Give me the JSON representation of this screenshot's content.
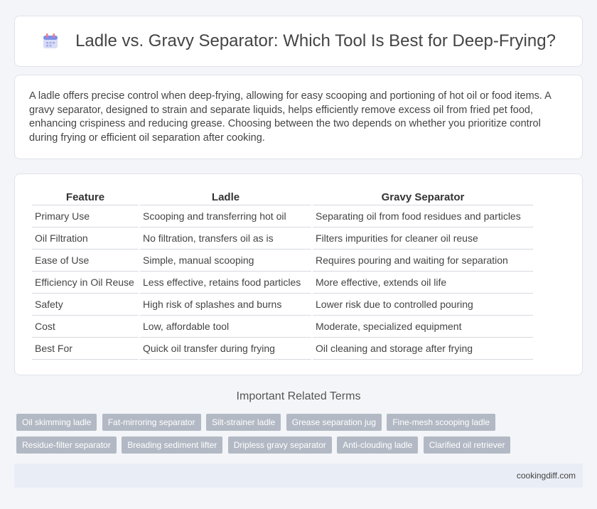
{
  "header": {
    "title": "Ladle vs. Gravy Separator: Which Tool Is Best for Deep-Frying?",
    "icon": "calendar-icon"
  },
  "intro": {
    "text": "A ladle offers precise control when deep-frying, allowing for easy scooping and portioning of hot oil or food items. A gravy separator, designed to strain and separate liquids, helps efficiently remove excess oil from fried pet food, enhancing crispiness and reducing grease. Choosing between the two depends on whether you prioritize control during frying or efficient oil separation after cooking."
  },
  "table": {
    "headers": [
      "Feature",
      "Ladle",
      "Gravy Separator"
    ],
    "rows": [
      [
        "Primary Use",
        "Scooping and transferring hot oil",
        "Separating oil from food residues and particles"
      ],
      [
        "Oil Filtration",
        "No filtration, transfers oil as is",
        "Filters impurities for cleaner oil reuse"
      ],
      [
        "Ease of Use",
        "Simple, manual scooping",
        "Requires pouring and waiting for separation"
      ],
      [
        "Efficiency in Oil Reuse",
        "Less effective, retains food particles",
        "More effective, extends oil life"
      ],
      [
        "Safety",
        "High risk of splashes and burns",
        "Lower risk due to controlled pouring"
      ],
      [
        "Cost",
        "Low, affordable tool",
        "Moderate, specialized equipment"
      ],
      [
        "Best For",
        "Quick oil transfer during frying",
        "Oil cleaning and storage after frying"
      ]
    ]
  },
  "related": {
    "title": "Important Related Terms",
    "tags": [
      "Oil skimming ladle",
      "Fat-mirroring separator",
      "Silt-strainer ladle",
      "Grease separation jug",
      "Fine-mesh scooping ladle",
      "Residue-filter separator",
      "Breading sediment lifter",
      "Dripless gravy separator",
      "Anti-clouding ladle",
      "Clarified oil retriever"
    ]
  },
  "footer": {
    "site": "cookingdiff.com"
  },
  "colors": {
    "background": "#f4f5f8",
    "tag_bg": "#b2b9c4",
    "footer_bg": "#e9edf5"
  }
}
